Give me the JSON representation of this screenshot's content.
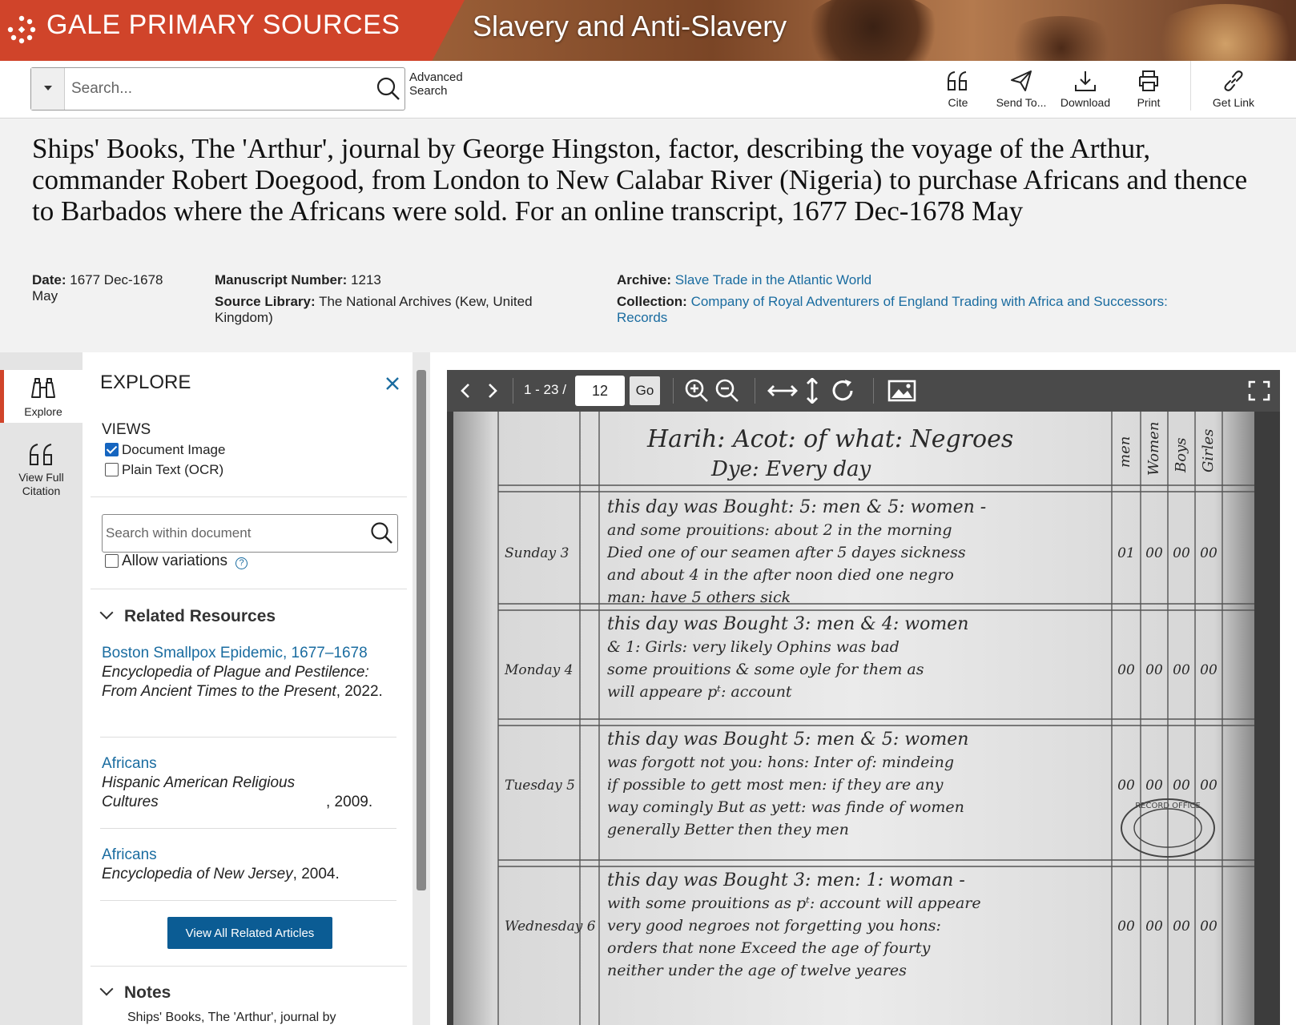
{
  "brand": {
    "title": "GALE PRIMARY SOURCES",
    "collection": "Slavery and Anti-Slavery",
    "color": "#d0442a"
  },
  "toolbar": {
    "search_placeholder": "Search...",
    "advanced_search": "Advanced Search",
    "tools": [
      {
        "label": "Cite",
        "icon": "cite-icon"
      },
      {
        "label": "Send To...",
        "icon": "send-icon"
      },
      {
        "label": "Download",
        "icon": "download-icon"
      },
      {
        "label": "Print",
        "icon": "print-icon"
      },
      {
        "label": "Get Link",
        "icon": "link-icon"
      }
    ]
  },
  "document": {
    "title": "Ships' Books, The 'Arthur', journal by George Hingston, factor, describing the voyage of the Arthur, commander Robert Doegood, from London to New Calabar River (Nigeria) to purchase Africans and thence to Barbados where the Africans were sold. For an online transcript, 1677 Dec-1678 May",
    "date_label": "Date:",
    "date_value": "1677 Dec-1678 May",
    "manuscript_label": "Manuscript Number:",
    "manuscript_value": "1213",
    "source_label": "Source Library:",
    "source_value": "The National Archives (Kew, United Kingdom)",
    "archive_label": "Archive:",
    "archive_value": "Slave Trade in the Atlantic World",
    "collection_label": "Collection:",
    "collection_value": "Company of Royal Adventurers of England Trading with Africa and Successors: Records"
  },
  "rail": {
    "items": [
      {
        "label": "Explore",
        "icon": "binoculars-icon",
        "active": true
      },
      {
        "label": "View Full Citation",
        "icon": "cite-icon",
        "active": false
      }
    ]
  },
  "explore": {
    "title": "EXPLORE",
    "views_label": "VIEWS",
    "views": [
      {
        "label": "Document Image",
        "checked": true
      },
      {
        "label": "Plain Text (OCR)",
        "checked": false
      }
    ],
    "search_placeholder": "Search within document",
    "allow_variations": "Allow variations",
    "related_title": "Related Resources",
    "related": [
      {
        "title": "Boston Smallpox Epidemic, 1677–1678",
        "source": "Encyclopedia of Plague and Pestilence: From Ancient Times to the Present",
        "year": ", 2022."
      },
      {
        "title": "Africans",
        "source": "Hispanic American Religious Cultures",
        "year": ", 2009."
      },
      {
        "title": "Africans",
        "source": "Encyclopedia of New Jersey",
        "year": ", 2004."
      }
    ],
    "view_all": "View All Related Articles",
    "notes_title": "Notes",
    "notes_text": "Ships' Books, The 'Arthur', journal by"
  },
  "viewer": {
    "page_range": "1 - 23 /",
    "page_value": "12",
    "go_label": "Go"
  },
  "manuscript": {
    "header": [
      "Harih: Acot: of what: Negroes",
      "Dye: Every day",
      "men",
      "Women",
      "Boys",
      "Girles"
    ],
    "entries": [
      {
        "day": "Sunday 3",
        "lines": [
          "this day was Bought: 5: men & 5: women -",
          "and some prouitions: about 2 in the morning",
          "Died one of our seamen after 5 dayes sickness",
          "and about 4 in the after noon died one negro",
          "man: have 5 others sick"
        ],
        "tally": [
          "01",
          "00",
          "00",
          "00"
        ]
      },
      {
        "day": "Monday 4",
        "lines": [
          "this day was Bought 3: men & 4: women",
          "& 1: Girls: very likely Ophins was bad",
          "some prouitions & some oyle for them as",
          "will appeare pᵗ: account"
        ],
        "tally": [
          "00",
          "00",
          "00",
          "00"
        ]
      },
      {
        "day": "Tuesday 5",
        "lines": [
          "this day was Bought 5: men & 5: women",
          "was forgott not you: hons: Inter of: mindeing",
          "if possible to gett most men: if they are any",
          "way comingly But as yett: was finde of women",
          "generally Better then they men"
        ],
        "tally": [
          "00",
          "00",
          "00",
          "00"
        ]
      },
      {
        "day": "Wednesday 6",
        "lines": [
          "this day was Bought 3: men: 1: woman -",
          "with some prouitions as pᵗ: account will appeare",
          "very good negroes not forgetting you hons:",
          "orders that none Exceed the age of fourty",
          "neither under the age of twelve yeares"
        ],
        "tally": [
          "00",
          "00",
          "00",
          "00"
        ]
      }
    ],
    "stamp": "RECORD OFFICE"
  }
}
